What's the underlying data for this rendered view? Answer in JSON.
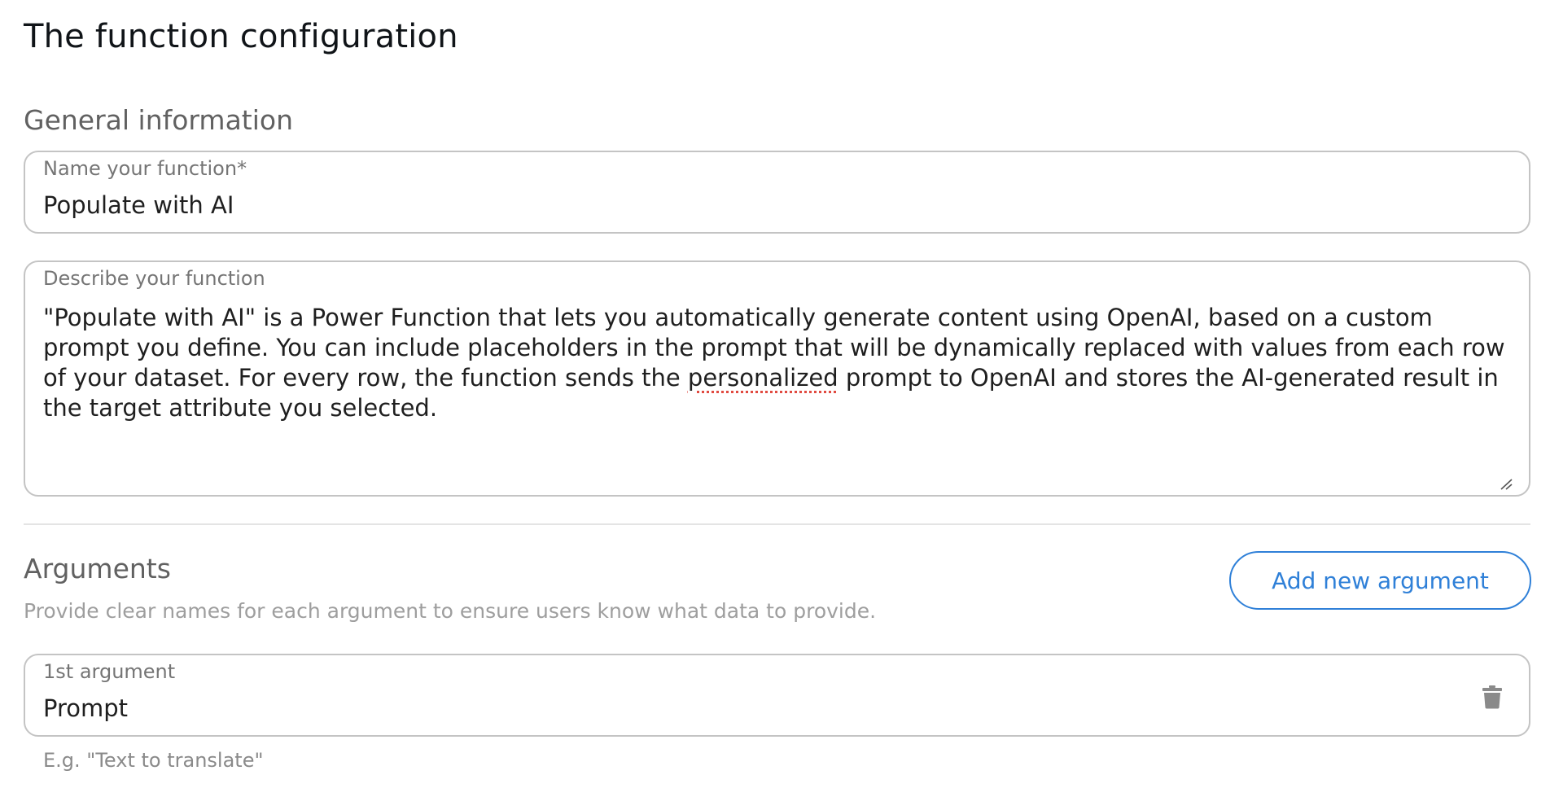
{
  "page": {
    "title": "The function configuration"
  },
  "general": {
    "heading": "General information",
    "name_field": {
      "label": "Name your function*",
      "value": "Populate with AI"
    },
    "description_field": {
      "label": "Describe your function",
      "value_before": "\"Populate with AI\" is a Power Function that lets you automatically generate content using OpenAI, based on a custom prompt you define. You can include placeholders in the prompt that will be dynamically replaced with values from each row of your dataset. For every row, the function sends the ",
      "value_flagged": "personalized",
      "value_after": " prompt to OpenAI and stores the AI-generated result in the target attribute you selected."
    }
  },
  "arguments": {
    "heading": "Arguments",
    "helper": "Provide clear names for each argument to ensure users know what data to provide.",
    "add_button_label": "Add new argument",
    "items": [
      {
        "label": "1st argument",
        "value": "Prompt",
        "hint": "E.g. \"Text to translate\""
      }
    ]
  },
  "colors": {
    "accent": "#2f80d8",
    "border": "#c4c4c4",
    "heading": "#616161",
    "spellcheck": "#e0453a"
  },
  "icons": {
    "delete": "trash-icon",
    "resize": "resize-handle-icon"
  }
}
